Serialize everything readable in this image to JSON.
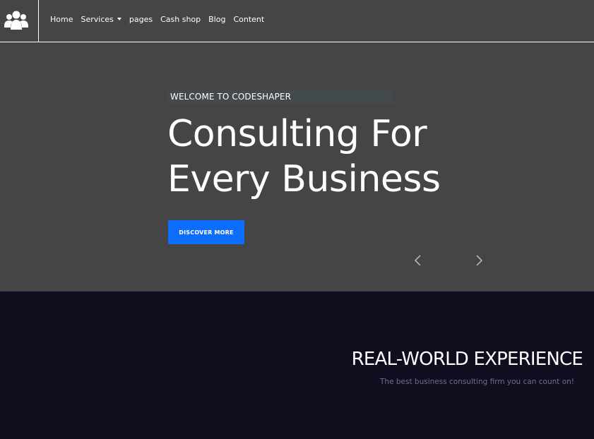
{
  "colors": {
    "header_bg": "#454545",
    "hero_bg": "#454545",
    "badge_bg": "#434a4d",
    "cta_bg": "#0d6efd",
    "section_bg": "#0f0d1e",
    "subtitle_text": "#6e6f8a"
  },
  "header": {
    "logo_icon": "users-icon",
    "nav": [
      {
        "label": "Home"
      },
      {
        "label": "Services",
        "has_dropdown": true
      },
      {
        "label": "pages"
      },
      {
        "label": "Cash shop"
      },
      {
        "label": "Blog"
      },
      {
        "label": "Content"
      }
    ]
  },
  "hero": {
    "badge": "WELCOME TO CODESHAPER",
    "title_line1": "Consulting For",
    "title_line2": "Every Business",
    "cta_label": "DISCOVER MORE",
    "prev_icon": "chevron-left-icon",
    "next_icon": "chevron-right-icon"
  },
  "experience": {
    "title": "REAL-WORLD EXPERIENCE",
    "subtitle": "The best business consulting firm you can count on!"
  }
}
